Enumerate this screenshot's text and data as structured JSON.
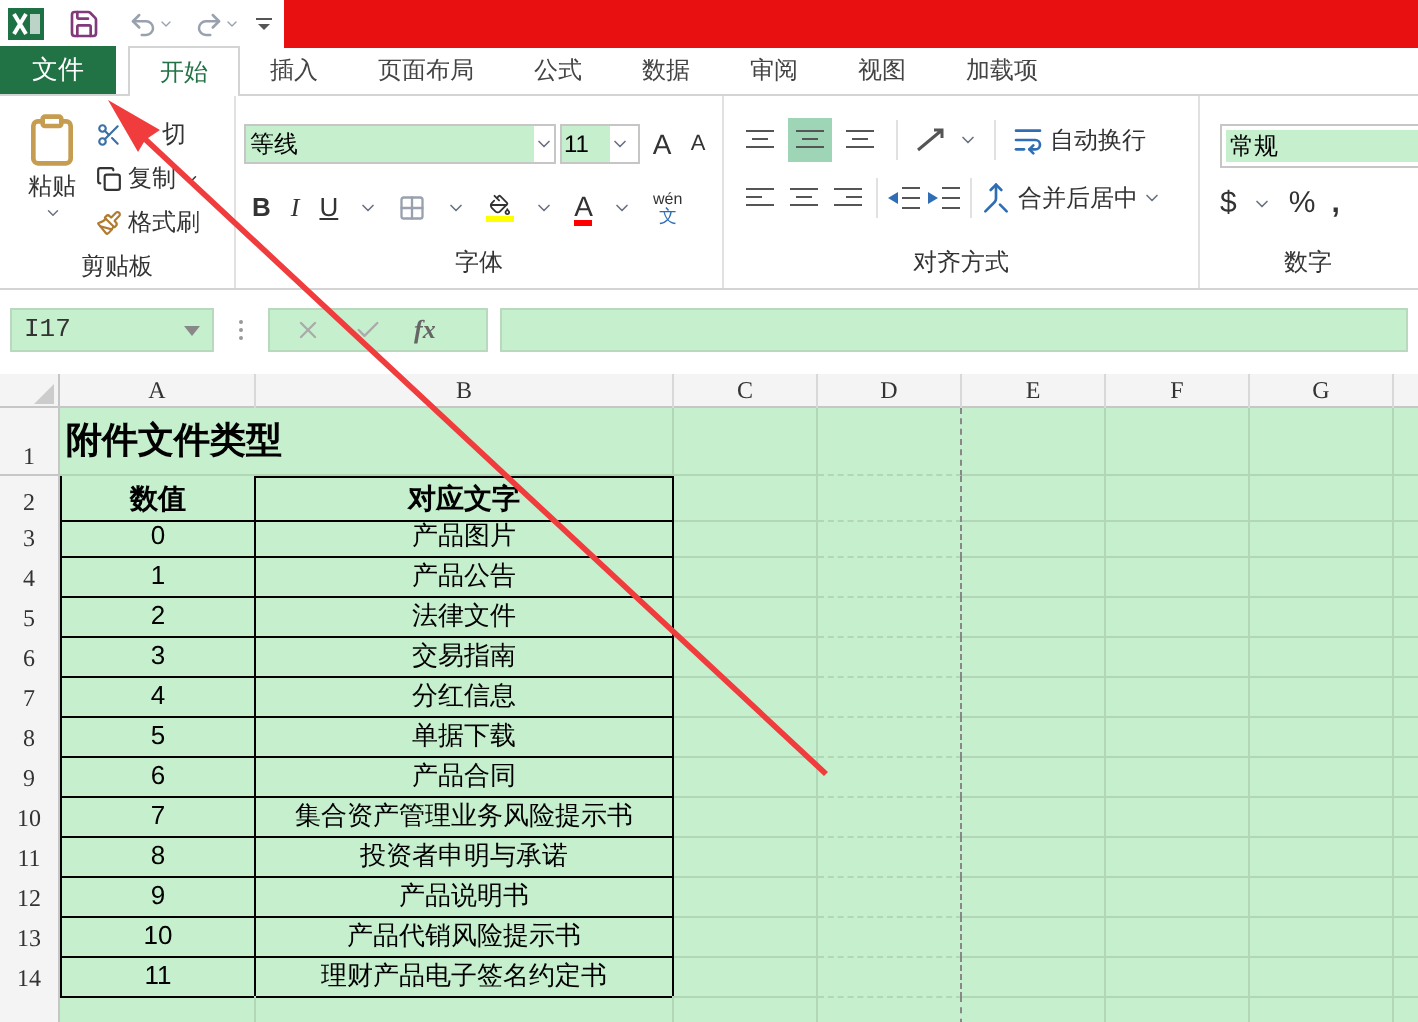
{
  "tabs": [
    {
      "label": "文件",
      "kind": "file",
      "selected": false
    },
    {
      "label": "开始",
      "kind": "tab",
      "selected": true
    },
    {
      "label": "插入",
      "kind": "tab",
      "selected": false
    },
    {
      "label": "页面布局",
      "kind": "tab",
      "selected": false
    },
    {
      "label": "公式",
      "kind": "tab",
      "selected": false
    },
    {
      "label": "数据",
      "kind": "tab",
      "selected": false
    },
    {
      "label": "审阅",
      "kind": "tab",
      "selected": false
    },
    {
      "label": "视图",
      "kind": "tab",
      "selected": false
    },
    {
      "label": "加载项",
      "kind": "tab",
      "selected": false
    }
  ],
  "ribbon": {
    "clipboard": {
      "paste": "粘贴",
      "cut": "切",
      "copy": "复制",
      "format_painter": "格式刷",
      "label": "剪贴板"
    },
    "font": {
      "name": "等线",
      "size": "11",
      "grow": "A",
      "shrink": "A",
      "bold": "B",
      "italic": "I",
      "underline": "U",
      "font_color": "A",
      "phonetic_top": "wén",
      "phonetic_bottom": "文",
      "label": "字体"
    },
    "alignment": {
      "wrap": "自动换行",
      "merge": "合并后居中",
      "label": "对齐方式",
      "middle_selected": true
    },
    "number": {
      "format": "常规",
      "currency": "$",
      "percent": "%",
      "comma": ",",
      "label": "数字"
    }
  },
  "formula_bar": {
    "name_box": "I17",
    "fx": "fx"
  },
  "sheet": {
    "columns": [
      "A",
      "B",
      "C",
      "D",
      "E",
      "F",
      "G"
    ],
    "rows": [
      {
        "number": "1",
        "kind": "title",
        "a": "附件文件类型"
      },
      {
        "number": "2",
        "kind": "header",
        "a": "数值",
        "b": "对应文字"
      },
      {
        "number": "3",
        "kind": "data",
        "a": "0",
        "b": "产品图片"
      },
      {
        "number": "4",
        "kind": "data",
        "a": "1",
        "b": "产品公告"
      },
      {
        "number": "5",
        "kind": "data",
        "a": "2",
        "b": "法律文件"
      },
      {
        "number": "6",
        "kind": "data",
        "a": "3",
        "b": "交易指南"
      },
      {
        "number": "7",
        "kind": "data",
        "a": "4",
        "b": "分红信息"
      },
      {
        "number": "8",
        "kind": "data",
        "a": "5",
        "b": "单据下载"
      },
      {
        "number": "9",
        "kind": "data",
        "a": "6",
        "b": "产品合同"
      },
      {
        "number": "10",
        "kind": "data",
        "a": "7",
        "b": "集合资产管理业务风险提示书"
      },
      {
        "number": "11",
        "kind": "data",
        "a": "8",
        "b": "投资者申明与承诺"
      },
      {
        "number": "12",
        "kind": "data",
        "a": "9",
        "b": "产品说明书"
      },
      {
        "number": "13",
        "kind": "data",
        "a": "10",
        "b": "产品代销风险提示书"
      },
      {
        "number": "14",
        "kind": "data",
        "a": "11",
        "b": "理财产品电子签名约定书"
      },
      {
        "kind": "empty"
      }
    ]
  }
}
